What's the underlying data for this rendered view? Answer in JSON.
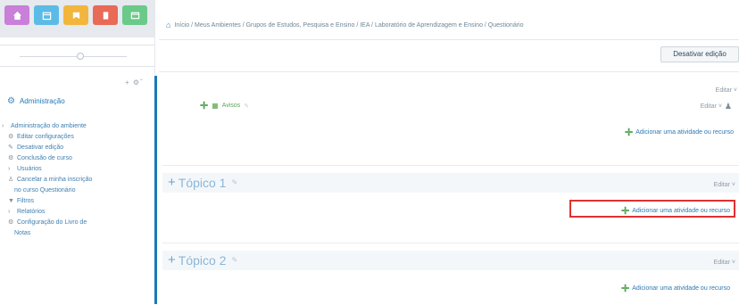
{
  "topbar": {
    "buttons": [
      {
        "icon": "home-icon",
        "color": "#c880d8"
      },
      {
        "icon": "calendar-icon",
        "color": "#5bbbe6"
      },
      {
        "icon": "star-icon",
        "color": "#f2b63d"
      },
      {
        "icon": "bookmark-icon",
        "color": "#e86a57"
      },
      {
        "icon": "window-icon",
        "color": "#6bc98a"
      }
    ]
  },
  "sidebar": {
    "block_controls": "+ ⚙ˇ",
    "header": "Administração",
    "items": [
      {
        "label": "Administração do ambiente",
        "icon": "›",
        "level": "root"
      },
      {
        "label": "Editar configurações",
        "icon": "⚙",
        "level": "child"
      },
      {
        "label": "Desativar edição",
        "icon": "✎",
        "level": "child"
      },
      {
        "label": "Conclusão de curso",
        "icon": "⚙",
        "level": "child"
      },
      {
        "label": "Usuários",
        "icon": "›",
        "level": "child"
      },
      {
        "label": "Cancelar a minha inscrição",
        "icon": "♙",
        "level": "child"
      },
      {
        "label": "no curso Questionário",
        "icon": "",
        "level": "sub"
      },
      {
        "label": "Filtros",
        "icon": "▼",
        "level": "child"
      },
      {
        "label": "Relatórios",
        "icon": "›",
        "level": "child"
      },
      {
        "label": "Configuração do Livro de",
        "icon": "⚙",
        "level": "child"
      },
      {
        "label": "Notas",
        "icon": "",
        "level": "sub"
      }
    ]
  },
  "breadcrumb": "Início / Meus Ambientes / Grupos de Estudos, Pesquisa e Ensino / IEA / Laboratório de Aprendizagem e Ensino / Questionário",
  "edit_button": "Desativar edição",
  "section0": {
    "editar": "Editar ˅",
    "editar_user": "Editar ˅",
    "news_label": "Avisos",
    "add_link": "Adicionar uma atividade ou recurso"
  },
  "topics": [
    {
      "title": "Tópico 1",
      "editar": "Editar ˅",
      "add_link": "Adicionar uma atividade ou recurso"
    },
    {
      "title": "Tópico 2",
      "editar": "Editar ˅",
      "add_link": "Adicionar uma atividade ou recurso"
    }
  ],
  "colors": {
    "accent": "#1c78b5",
    "highlight": "#e03131",
    "add_icon": "#4da14d"
  }
}
